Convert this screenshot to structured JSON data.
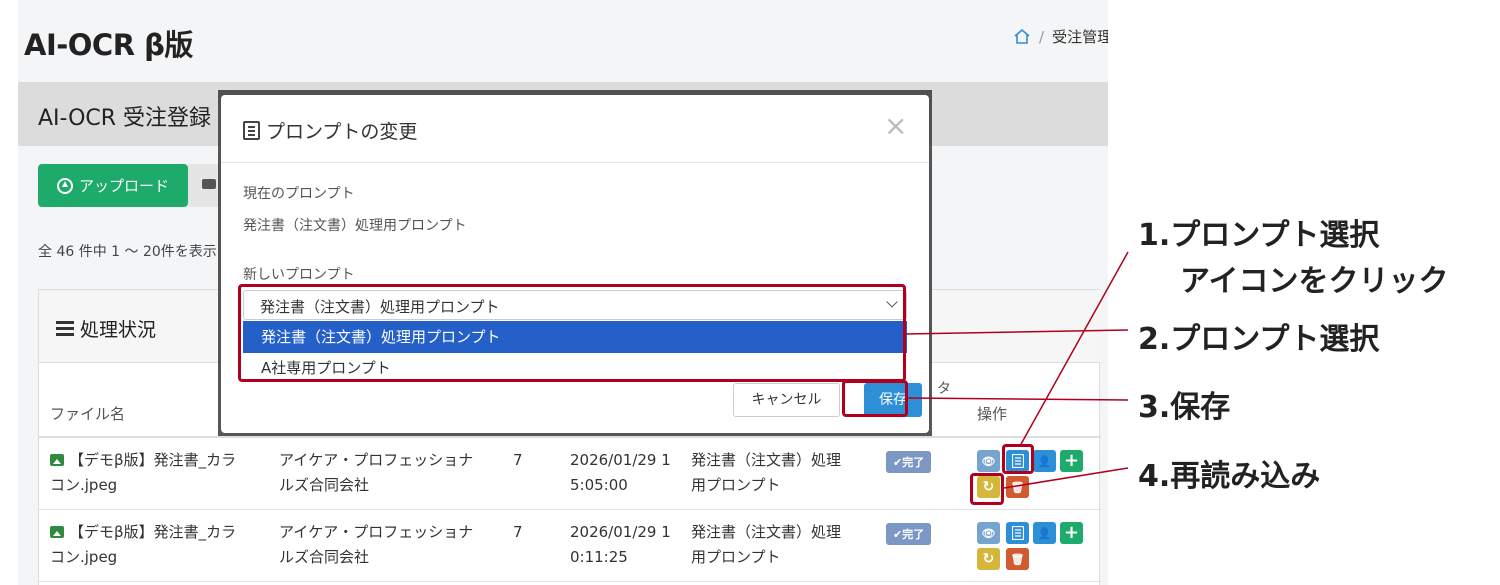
{
  "app": {
    "title": "AI-OCR β版",
    "breadcrumb": [
      "受注管理"
    ],
    "sub_title": "AI-OCR 受注登録",
    "upload_label": "アップロード",
    "count_text": "全 46 件中 1 〜 20件を表示",
    "panel_title": "処理状況",
    "columns": {
      "file": "ファイル名",
      "extra_fragment": "タ",
      "actions": "操作"
    },
    "rows": [
      {
        "file_line1": "【デモβ版】発注書_カラ",
        "file_line2": "コン.jpeg",
        "company_line1": "アイケア・プロフェッショナ",
        "company_line2": "ルズ合同会社",
        "pages": "7",
        "date_line1": "2026/01/29 1",
        "date_line2": "5:05:00",
        "prompt_line1": "発注書（注文書）処理",
        "prompt_line2": "用プロンプト",
        "status": "✔完了"
      },
      {
        "file_line1": "【デモβ版】発注書_カラ",
        "file_line2": "コン.jpeg",
        "company_line1": "アイケア・プロフェッショナ",
        "company_line2": "ルズ合同会社",
        "pages": "7",
        "date_line1": "2026/01/29 1",
        "date_line2": "0:11:25",
        "prompt_line1": "発注書（注文書）処理",
        "prompt_line2": "用プロンプト",
        "status": "✔完了"
      }
    ],
    "action_glyphs": {
      "view": "👁",
      "user": "👤",
      "add": "+",
      "reload": "↻",
      "trash": "🗑"
    }
  },
  "modal": {
    "title": "プロンプトの変更",
    "current_label": "現在のプロンプト",
    "current_value": "発注書（注文書）処理用プロンプト",
    "new_label": "新しいプロンプト",
    "selected_value": "発注書（注文書）処理用プロンプト",
    "options": [
      "発注書（注文書）処理用プロンプト",
      "A社専用プロンプト"
    ],
    "cancel_label": "キャンセル",
    "save_label": "保存",
    "close_glyph": "×"
  },
  "annotations": {
    "step1_line1": "1.プロンプト選択",
    "step1_line2": "アイコンをクリック",
    "step2": "2.プロンプト選択",
    "step3": "3.保存",
    "step4": "4.再読み込み",
    "highlight_color": "#b1001d"
  },
  "colors": {
    "upload_green": "#1eaa6a",
    "primary_blue": "#2d8fd6",
    "selected_option": "#2560c9",
    "status_badge": "#7c97c4",
    "reload_yellow": "#d4b73a",
    "trash_red": "#d15b2f"
  }
}
